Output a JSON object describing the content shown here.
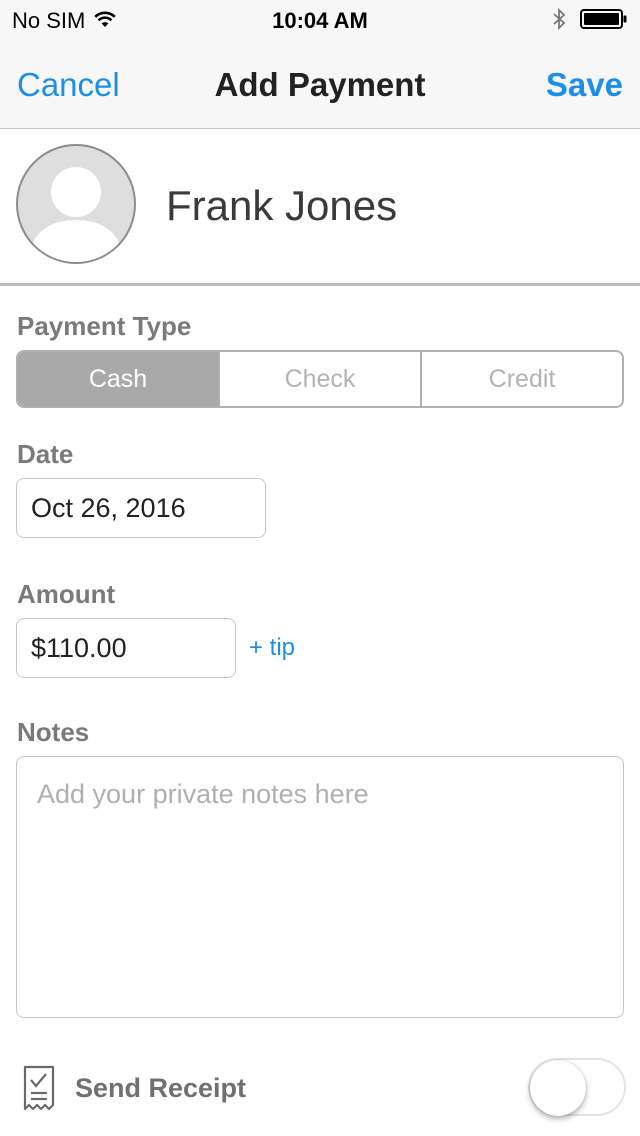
{
  "status_bar": {
    "carrier": "No SIM",
    "time": "10:04 AM",
    "icons": [
      "wifi-icon",
      "bluetooth-icon",
      "battery-icon"
    ]
  },
  "nav": {
    "cancel_label": "Cancel",
    "title": "Add Payment",
    "save_label": "Save"
  },
  "profile": {
    "name": "Frank Jones",
    "avatar_icon": "person-placeholder-icon"
  },
  "payment_type": {
    "label": "Payment Type",
    "options": [
      "Cash",
      "Check",
      "Credit"
    ],
    "selected": "Cash"
  },
  "date": {
    "label": "Date",
    "value": "Oct 26, 2016"
  },
  "amount": {
    "label": "Amount",
    "value": "$110.00",
    "tip_label": "+ tip"
  },
  "notes": {
    "label": "Notes",
    "placeholder": "Add your private notes here",
    "value": ""
  },
  "receipt": {
    "label": "Send Receipt",
    "icon": "receipt-icon",
    "enabled": false
  },
  "colors": {
    "accent": "#1e8fe6",
    "segment_selected": "#a9a9a9",
    "label_gray": "#7a7a7a"
  }
}
